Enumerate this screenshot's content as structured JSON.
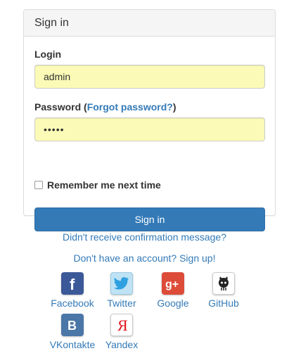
{
  "panel": {
    "title": "Sign in",
    "login_label": "Login",
    "login_value": "admin",
    "password_label_prefix": "Password (",
    "forgot_password": "Forgot password?",
    "password_label_suffix": ")",
    "password_value": "•••••",
    "remember_label": "Remember me next time",
    "remember_checked": false,
    "submit_label": "Sign in"
  },
  "links": {
    "confirmation": "Didn't receive confirmation message?",
    "signup": "Don't have an account? Sign up!"
  },
  "social": [
    {
      "name": "Facebook",
      "icon": "facebook-icon",
      "color": "#3b5998"
    },
    {
      "name": "Twitter",
      "icon": "twitter-icon",
      "color": "#55acee"
    },
    {
      "name": "Google",
      "icon": "google-plus-icon",
      "color": "#dd4b39"
    },
    {
      "name": "GitHub",
      "icon": "github-icon",
      "color": "#ffffff"
    },
    {
      "name": "VKontakte",
      "icon": "vkontakte-icon",
      "color": "#4a76a8"
    },
    {
      "name": "Yandex",
      "icon": "yandex-icon",
      "color": "#ffffff"
    }
  ],
  "colors": {
    "link": "#337ab7",
    "primary_button": "#337ab7",
    "autofill_input": "#fbfbb7"
  }
}
